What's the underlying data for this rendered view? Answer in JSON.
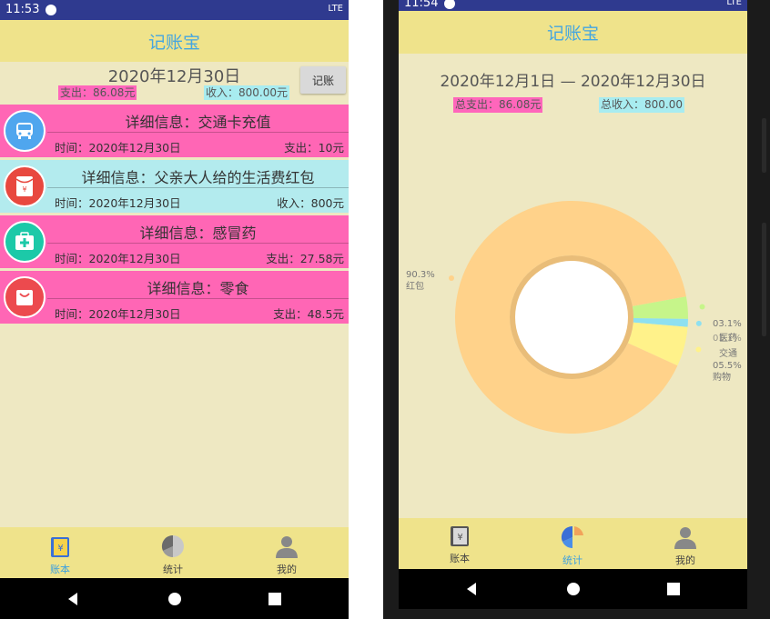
{
  "left": {
    "status": {
      "time": "11:53",
      "network": "LTE"
    },
    "app_title": "记账宝",
    "date": "2020年12月30日",
    "expense_summary": "支出：86.08元",
    "income_summary": "收入：800.00元",
    "record_button": "记账",
    "records": [
      {
        "title": "详细信息：交通卡充值",
        "time": "时间：2020年12月30日",
        "amount": "支出：10元",
        "icon": "bus-icon",
        "color": "pink"
      },
      {
        "title": "详细信息：父亲大人给的生活费红包",
        "time": "时间：2020年12月30日",
        "amount": "收入：800元",
        "icon": "red-envelope-icon",
        "color": "cyan"
      },
      {
        "title": "详细信息：感冒药",
        "time": "时间：2020年12月30日",
        "amount": "支出：27.58元",
        "icon": "medical-kit-icon",
        "color": "pink"
      },
      {
        "title": "详细信息：零食",
        "time": "时间：2020年12月30日",
        "amount": "支出：48.5元",
        "icon": "shopping-bag-icon",
        "color": "pink"
      }
    ],
    "nav": [
      {
        "label": "账本",
        "icon": "ledger-icon",
        "active": true
      },
      {
        "label": "统计",
        "icon": "pie-chart-icon",
        "active": false
      },
      {
        "label": "我的",
        "icon": "person-icon",
        "active": false
      }
    ]
  },
  "right": {
    "status": {
      "time": "11:54",
      "network": "LTE"
    },
    "app_title": "记账宝",
    "date_range": "2020年12月1日  —  2020年12月30日",
    "total_expense": "总支出：86.08元",
    "total_income": "总收入：800.00",
    "nav": [
      {
        "label": "账本",
        "icon": "ledger-icon",
        "active": false
      },
      {
        "label": "统计",
        "icon": "pie-chart-icon",
        "active": true
      },
      {
        "label": "我的",
        "icon": "person-icon",
        "active": false
      }
    ]
  },
  "chart_data": {
    "type": "pie",
    "slices": [
      {
        "label": "红包",
        "percent_text": "90.3%",
        "value": 90.3,
        "color": "#ffd28a"
      },
      {
        "label": "医药",
        "percent_text": "03.1%",
        "value": 3.1,
        "color": "#c6f58a"
      },
      {
        "label": "交通",
        "percent_text": "01.1%",
        "value": 1.1,
        "color": "#8ee0f0"
      },
      {
        "label": "购物",
        "percent_text": "05.5%",
        "value": 5.5,
        "color": "#fff28a"
      }
    ],
    "center_hole": true
  }
}
